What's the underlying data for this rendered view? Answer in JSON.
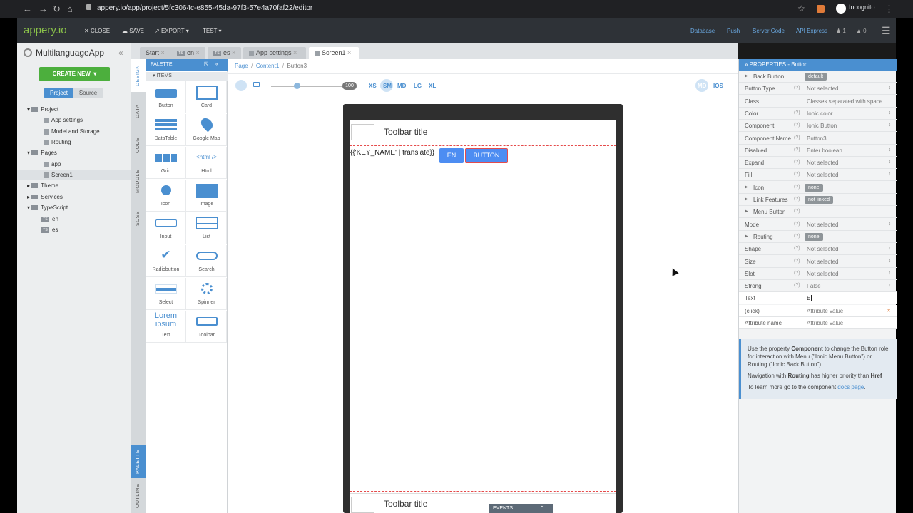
{
  "browser": {
    "url": "appery.io/app/project/5fc3064c-e855-45da-97f3-57e4a70faf22/editor",
    "url_host": "appery.io",
    "incognito_label": "Incognito"
  },
  "app_toolbar": {
    "logo": "appery.io",
    "close_label": "CLOSE",
    "save_label": "SAVE",
    "export_label": "EXPORT",
    "test_label": "TEST",
    "links": [
      "Database",
      "Push",
      "Server Code",
      "API Express"
    ],
    "user_count": "1",
    "notification_count": "0"
  },
  "project": {
    "title": "MultilanguageApp",
    "create_new_label": "CREATE NEW",
    "tabs": [
      "Project",
      "Source"
    ],
    "tree": [
      {
        "label": "Project",
        "type": "folder",
        "level": 0
      },
      {
        "label": "App settings",
        "type": "file",
        "level": 1
      },
      {
        "label": "Model and Storage",
        "type": "file",
        "level": 1
      },
      {
        "label": "Routing",
        "type": "file",
        "level": 1
      },
      {
        "label": "Pages",
        "type": "folder",
        "level": 0
      },
      {
        "label": "app",
        "type": "file",
        "level": 1
      },
      {
        "label": "Screen1",
        "type": "file",
        "level": 1,
        "selected": true
      },
      {
        "label": "Theme",
        "type": "folder",
        "level": 0
      },
      {
        "label": "Services",
        "type": "folder",
        "level": 0
      },
      {
        "label": "TypeScript",
        "type": "folder",
        "level": 0
      },
      {
        "label": "en",
        "type": "ts",
        "level": 1
      },
      {
        "label": "es",
        "type": "ts",
        "level": 1
      }
    ]
  },
  "editor_tabs": [
    {
      "label": "Start",
      "active": false
    },
    {
      "label": "en",
      "active": false
    },
    {
      "label": "es",
      "active": false
    },
    {
      "label": "App settings",
      "active": false
    },
    {
      "label": "Screen1",
      "active": true
    }
  ],
  "vertical_tabs": [
    "DESIGN",
    "DATA",
    "CODE",
    "MODULE",
    "SCSS"
  ],
  "vertical_tabs_bottom": [
    "PALETTE",
    "OUTLINE"
  ],
  "palette": {
    "title": "PALETTE",
    "section": "ITEMS",
    "items": [
      "Button",
      "Card",
      "DataTable",
      "Google Map",
      "Grid",
      "Html",
      "Icon",
      "Image",
      "Input",
      "List",
      "Radiobutton",
      "Search",
      "Select",
      "Spinner",
      "Text",
      "Toolbar"
    ],
    "lorem": "Lorem ipsum",
    "html_tag": "<html />"
  },
  "breadcrumb": [
    "Page",
    "Content1",
    "Button3"
  ],
  "device_bar": {
    "zoom": "100",
    "breakpoints": [
      "XS",
      "SM",
      "MD",
      "LG",
      "XL"
    ],
    "active_breakpoint": "SM",
    "platform_md": "MD",
    "platform_ios": "IOS"
  },
  "canvas": {
    "toolbar_title": "Toolbar title",
    "footer_toolbar_title": "Toolbar title",
    "translate_text": "{{'KEY_NAME' | translate}}",
    "en_button": "EN",
    "button_label": "BUTTON",
    "events_label": "EVENTS"
  },
  "properties": {
    "title": "PROPERTIES - Button",
    "rows": [
      {
        "name": "Back Button",
        "tag": "default",
        "expandable": true
      },
      {
        "name": "Button Type",
        "value": "Not selected",
        "help": true,
        "select": true
      },
      {
        "name": "Class",
        "value": "Classes separated with space"
      },
      {
        "name": "Color",
        "value": "Ionic color",
        "help": true,
        "select": true
      },
      {
        "name": "Component",
        "value": "Ionic Button",
        "help": true,
        "select": true
      },
      {
        "name": "Component Name",
        "value": "Button3",
        "help": true
      },
      {
        "name": "Disabled",
        "value": "Enter boolean",
        "help": true,
        "select": true
      },
      {
        "name": "Expand",
        "value": "Not selected",
        "help": true,
        "select": true
      },
      {
        "name": "Fill",
        "value": "Not selected",
        "help": true,
        "select": true
      },
      {
        "name": "Icon",
        "tag": "none",
        "help": true,
        "expandable": true
      },
      {
        "name": "Link Features",
        "tag": "not linked",
        "help": true,
        "expandable": true
      },
      {
        "name": "Menu Button",
        "help": true,
        "expandable": true
      },
      {
        "name": "Mode",
        "value": "Not selected",
        "help": true,
        "select": true
      },
      {
        "name": "Routing",
        "tag": "none",
        "help": true,
        "expandable": true
      },
      {
        "name": "Shape",
        "value": "Not selected",
        "help": true,
        "select": true
      },
      {
        "name": "Size",
        "value": "Not selected",
        "help": true,
        "select": true
      },
      {
        "name": "Slot",
        "value": "Not selected",
        "help": true,
        "select": true
      },
      {
        "name": "Strong",
        "value": "False",
        "help": true,
        "select": true
      },
      {
        "name": "Text",
        "value": "E",
        "editing": true
      },
      {
        "name": "(click)",
        "value": "Attribute value",
        "removable": true
      },
      {
        "name": "Attribute name",
        "value": "Attribute value"
      }
    ],
    "info": [
      "Use the property Component to change the Button role for interaction with Menu (\"Ionic Menu Button\") or Routing (\"Ionic Back Button\")",
      "Navigation with Routing has higher priority than Href",
      "To learn more go to the component docs page."
    ]
  }
}
